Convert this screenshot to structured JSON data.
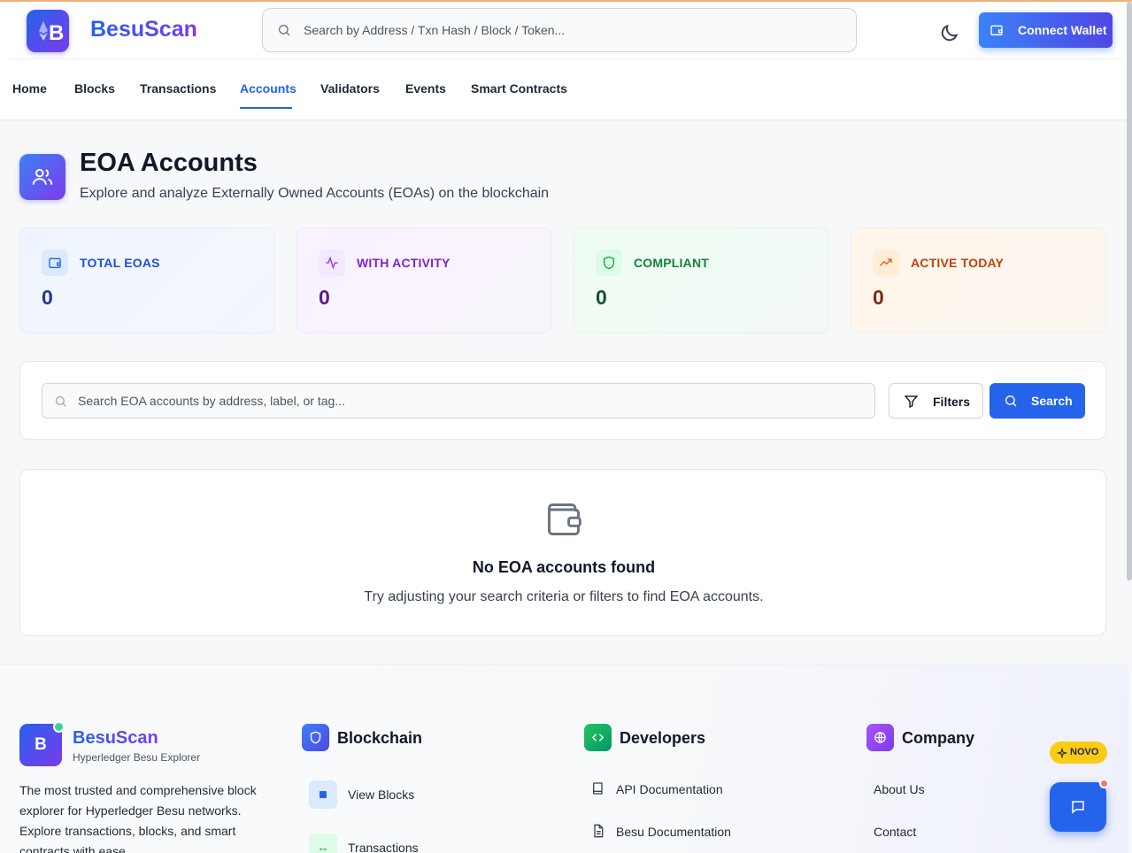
{
  "header": {
    "brand": "BesuScan",
    "search_placeholder": "Search by Address / Txn Hash / Block / Token...",
    "connect_wallet": "Connect Wallet"
  },
  "nav": {
    "items": [
      "Home",
      "Blocks",
      "Transactions",
      "Accounts",
      "Validators",
      "Events",
      "Smart Contracts"
    ],
    "active": "Accounts"
  },
  "page": {
    "title": "EOA Accounts",
    "subtitle": "Explore and analyze Externally Owned Accounts (EOAs) on the blockchain"
  },
  "stats": [
    {
      "label": "TOTAL EOAS",
      "value": "0",
      "icon": "wallet-icon",
      "color": "#1d4ed8"
    },
    {
      "label": "WITH ACTIVITY",
      "value": "0",
      "icon": "activity-icon",
      "color": "#7e22ce"
    },
    {
      "label": "COMPLIANT",
      "value": "0",
      "icon": "shield-icon",
      "color": "#15803d"
    },
    {
      "label": "ACTIVE TODAY",
      "value": "0",
      "icon": "trending-up-icon",
      "color": "#c2410c"
    }
  ],
  "filter_bar": {
    "placeholder": "Search EOA accounts by address, label, or tag...",
    "filters_label": "Filters",
    "search_label": "Search"
  },
  "empty_state": {
    "title": "No EOA accounts found",
    "message": "Try adjusting your search criteria or filters to find EOA accounts."
  },
  "footer": {
    "logo_letter": "B",
    "brand": "BesuScan",
    "tagline": "Hyperledger Besu Explorer",
    "description": "The most trusted and comprehensive block explorer for Hyperledger Besu networks. Explore transactions, blocks, and smart contracts with ease.",
    "blockchain": {
      "title": "Blockchain",
      "links": [
        "View Blocks",
        "Transactions"
      ]
    },
    "developers": {
      "title": "Developers",
      "links": [
        "API Documentation",
        "Besu Documentation"
      ]
    },
    "company": {
      "title": "Company",
      "links": [
        "About Us",
        "Contact"
      ]
    }
  },
  "widgets": {
    "novo_badge": "NOVO"
  }
}
